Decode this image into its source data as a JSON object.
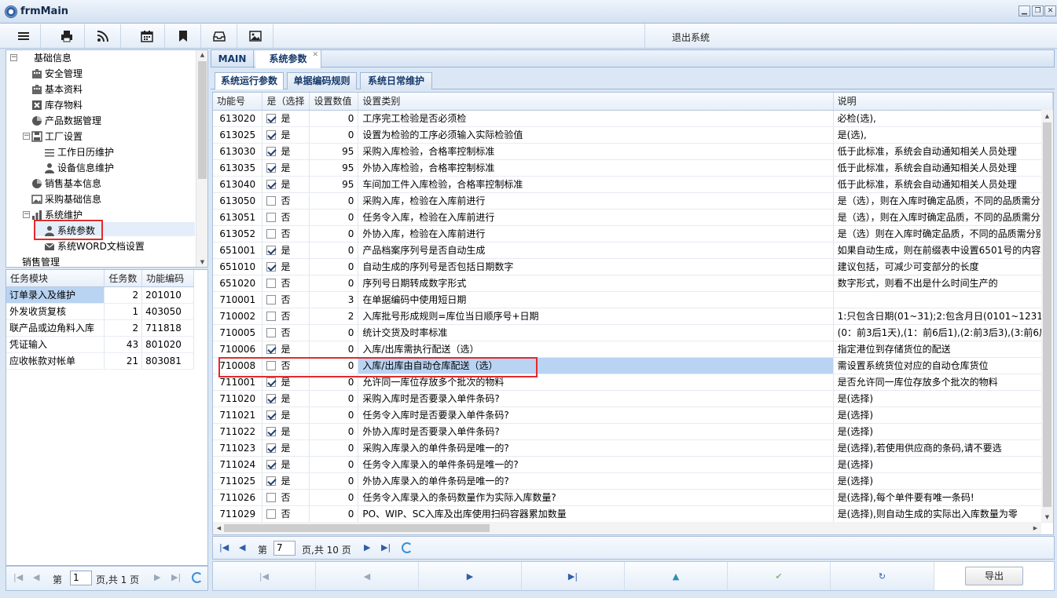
{
  "window": {
    "title": "frmMain"
  },
  "toolbar": {
    "icons": [
      "menu-icon",
      "print-icon",
      "rss-icon",
      "calendar-icon",
      "bookmark-icon",
      "inbox-icon",
      "image-icon"
    ],
    "logout_label": "退出系统"
  },
  "tree": {
    "root": "基础信息",
    "items": [
      {
        "label": "安全管理"
      },
      {
        "label": "基本资料"
      },
      {
        "label": "库存物料"
      },
      {
        "label": "产品数据管理"
      },
      {
        "label": "工厂设置"
      },
      {
        "label": "工作日历维护"
      },
      {
        "label": "设备信息维护"
      },
      {
        "label": "销售基本信息"
      },
      {
        "label": "采购基础信息"
      },
      {
        "label": "系统维护"
      },
      {
        "label": "系统参数"
      },
      {
        "label": "系统WORD文档设置"
      },
      {
        "label": "销售管理"
      }
    ]
  },
  "tasks": {
    "headers": [
      "任务模块",
      "任务数",
      "功能编码"
    ],
    "rows": [
      [
        "订单录入及维护",
        "2",
        "201010"
      ],
      [
        "外发收货复核",
        "1",
        "403050"
      ],
      [
        "联产品或边角料入库",
        "2",
        "711818"
      ],
      [
        "凭证输入",
        "43",
        "801020"
      ],
      [
        "应收帐款对帐单",
        "21",
        "803081"
      ]
    ]
  },
  "left_pager": {
    "page_prefix": "第",
    "page": "1",
    "page_suffix": "页,共 1 页"
  },
  "tabs": {
    "main": "MAIN",
    "params": "系统参数"
  },
  "subtabs": [
    "系统运行参数",
    "单据编码规则",
    "系统日常维护"
  ],
  "grid": {
    "headers": [
      "功能号",
      "是（选择",
      "设置数值",
      "设置类别",
      "说明"
    ],
    "rows": [
      {
        "code": "613020",
        "checked": true,
        "yn": "是",
        "value": "0",
        "type": "工序完工检验是否必须检",
        "desc": "必检(选),"
      },
      {
        "code": "613025",
        "checked": true,
        "yn": "是",
        "value": "0",
        "type": "设置为检验的工序必须输入实际检验值",
        "desc": "是(选),"
      },
      {
        "code": "613030",
        "checked": true,
        "yn": "是",
        "value": "95",
        "type": "采购入库检验，合格率控制标准",
        "desc": "低于此标准，系统会自动通知相关人员处理"
      },
      {
        "code": "613035",
        "checked": true,
        "yn": "是",
        "value": "95",
        "type": "外协入库检验，合格率控制标准",
        "desc": "低于此标准，系统会自动通知相关人员处理"
      },
      {
        "code": "613040",
        "checked": true,
        "yn": "是",
        "value": "95",
        "type": "车间加工件入库检验，合格率控制标准",
        "desc": "低于此标准，系统会自动通知相关人员处理"
      },
      {
        "code": "613050",
        "checked": false,
        "yn": "否",
        "value": "0",
        "type": "采购入库，检验在入库前进行",
        "desc": "是（选），则在入库时确定品质，不同的品质需分"
      },
      {
        "code": "613051",
        "checked": false,
        "yn": "否",
        "value": "0",
        "type": "任务令入库，检验在入库前进行",
        "desc": "是（选），则在入库时确定品质，不同的品质需分"
      },
      {
        "code": "613052",
        "checked": false,
        "yn": "否",
        "value": "0",
        "type": "外协入库，检验在入库前进行",
        "desc": "是（选）则在入库时确定品质，不同的品质需分别"
      },
      {
        "code": "651001",
        "checked": true,
        "yn": "是",
        "value": "0",
        "type": "产品档案序列号是否自动生成",
        "desc": "如果自动生成，则在前缀表中设置6501号的内容"
      },
      {
        "code": "651010",
        "checked": true,
        "yn": "是",
        "value": "0",
        "type": "自动生成的序列号是否包括日期数字",
        "desc": "建议包括，可减少可变部分的长度"
      },
      {
        "code": "651020",
        "checked": false,
        "yn": "否",
        "value": "0",
        "type": "序列号日期转成数字形式",
        "desc": "数字形式，则看不出是什么时间生产的"
      },
      {
        "code": "710001",
        "checked": false,
        "yn": "否",
        "value": "3",
        "type": "在单据编码中使用短日期",
        "desc": ""
      },
      {
        "code": "710002",
        "checked": false,
        "yn": "否",
        "value": "2",
        "type": "入库批号形成规则=库位当日顺序号+日期",
        "desc": "1:只包含日期(01~31);2:包含月日(0101~1231)"
      },
      {
        "code": "710005",
        "checked": false,
        "yn": "否",
        "value": "0",
        "type": "统计交货及时率标准",
        "desc": "(0：前3后1天),(1：前6后1),(2:前3后3),(3:前6后"
      },
      {
        "code": "710006",
        "checked": true,
        "yn": "是",
        "value": "0",
        "type": "入库/出库需执行配送（选）",
        "desc": "指定港位到存储货位的配送"
      },
      {
        "code": "710008",
        "checked": false,
        "yn": "否",
        "value": "0",
        "type": "入库/出库由自动仓库配送（选）",
        "desc": "需设置系统货位对应的自动仓库货位"
      },
      {
        "code": "711001",
        "checked": true,
        "yn": "是",
        "value": "0",
        "type": "允许同一库位存放多个批次的物料",
        "desc": "是否允许同一库位存放多个批次的物料"
      },
      {
        "code": "711020",
        "checked": true,
        "yn": "是",
        "value": "0",
        "type": "采购入库时是否要录入单件条码?",
        "desc": "是(选择)"
      },
      {
        "code": "711021",
        "checked": true,
        "yn": "是",
        "value": "0",
        "type": "任务令入库时是否要录入单件条码?",
        "desc": "是(选择)"
      },
      {
        "code": "711022",
        "checked": true,
        "yn": "是",
        "value": "0",
        "type": "外协入库时是否要录入单件条码?",
        "desc": "是(选择)"
      },
      {
        "code": "711023",
        "checked": true,
        "yn": "是",
        "value": "0",
        "type": "采购入库录入的单件条码是唯一的?",
        "desc": "是(选择),若使用供应商的条码,请不要选"
      },
      {
        "code": "711024",
        "checked": true,
        "yn": "是",
        "value": "0",
        "type": "任务令入库录入的单件条码是唯一的?",
        "desc": "是(选择)"
      },
      {
        "code": "711025",
        "checked": true,
        "yn": "是",
        "value": "0",
        "type": "外协入库录入的单件条码是唯一的?",
        "desc": "是(选择)"
      },
      {
        "code": "711026",
        "checked": false,
        "yn": "否",
        "value": "0",
        "type": "任务令入库录入的条码数量作为实际入库数量?",
        "desc": "是(选择),每个单件要有唯一条码!"
      },
      {
        "code": "711029",
        "checked": false,
        "yn": "否",
        "value": "0",
        "type": "PO、WIP、SC入库及出库使用扫码容器累加数量",
        "desc": "是(选择),则自动生成的实际出入库数量为零"
      }
    ]
  },
  "grid_pager": {
    "page_prefix": "第",
    "page": "7",
    "page_suffix": "页,共 10 页"
  },
  "nav": {
    "export_label": "导出"
  },
  "colors": {
    "accent": "#2f5fa8",
    "selection": "#b9d3f2",
    "highlight_border": "#e22b2b"
  }
}
